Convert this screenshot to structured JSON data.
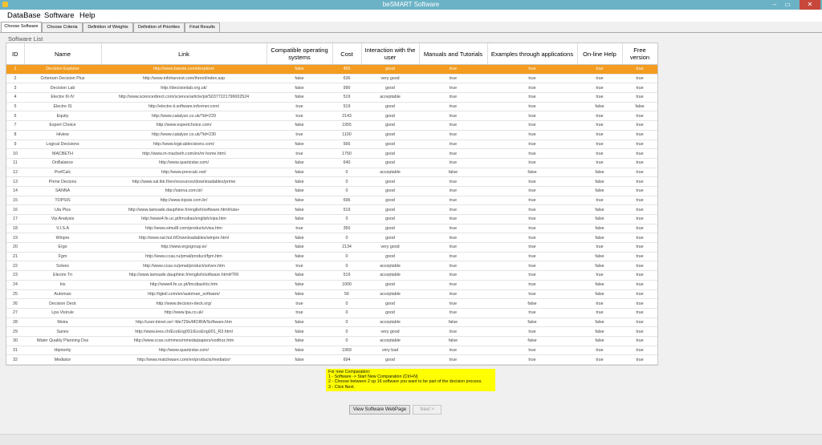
{
  "window": {
    "title": "beSMART Software",
    "minimize": "–",
    "maximize": "▭",
    "close": "✕"
  },
  "menu": [
    "DataBase",
    "Software",
    "Help"
  ],
  "tabs": [
    "Choose Software",
    "Choose Criteria",
    "Definition of Weights",
    "Definition of Priorities",
    "Final Results"
  ],
  "group_label": "Software List",
  "columns": [
    "ID",
    "Name",
    "Link",
    "Compatible operating systems",
    "Cost",
    "Interaction with the user",
    "Manuals and Tutorials",
    "Examples through applications",
    "On-line Help",
    "Free version"
  ],
  "selected_row_index": 0,
  "rows": [
    [
      "1",
      "Decision Explorer",
      "http://www.banxia.com/dexplore/",
      "false",
      "455",
      "good",
      "true",
      "true",
      "true",
      "true"
    ],
    [
      "2",
      "Criterium Decision Plus",
      "http://www.infoharvest.com/ihroot/index.asp",
      "false",
      "636",
      "very good",
      "true",
      "true",
      "true",
      "true"
    ],
    [
      "3",
      "Decision Lab",
      "http://decisionlab.org.uk/",
      "false",
      "990",
      "good",
      "true",
      "true",
      "true",
      "true"
    ],
    [
      "4",
      "Electre III-IV",
      "http://www.sciencedirect.com/science/article/pii/S0377221796002524",
      "false",
      "519",
      "acceptable",
      "true",
      "true",
      "true",
      "true"
    ],
    [
      "5",
      "Electre IS",
      "http://electre-ii.software.informer.com/",
      "true",
      "519",
      "good",
      "true",
      "true",
      "false",
      "false"
    ],
    [
      "6",
      "Equity",
      "http://www.catalyze.co.uk/?id=229",
      "true",
      "2143",
      "good",
      "true",
      "true",
      "true",
      "true"
    ],
    [
      "7",
      "Expert Choice",
      "http://www.expertchoice.com/",
      "false",
      "1955",
      "good",
      "true",
      "true",
      "true",
      "true"
    ],
    [
      "8",
      "Hiview",
      "http://www.catalyze.co.uk/?id=230",
      "true",
      "1100",
      "good",
      "true",
      "true",
      "true",
      "true"
    ],
    [
      "9",
      "Logical Decisions",
      "http://www.logicaldecisions.com/",
      "false",
      "566",
      "good",
      "true",
      "true",
      "true",
      "true"
    ],
    [
      "10",
      "MACBETH",
      "http://www.m-macbeth.com/en/m-home.html",
      "true",
      "1750",
      "good",
      "true",
      "true",
      "true",
      "true"
    ],
    [
      "11",
      "OnBalance",
      "http://www.quartzstar.com/",
      "false",
      "640",
      "good",
      "true",
      "true",
      "true",
      "true"
    ],
    [
      "12",
      "PrefCalc",
      "http://www.prevcalc.net/",
      "false",
      "0",
      "acceptable",
      "false",
      "false",
      "false",
      "true"
    ],
    [
      "13",
      "Prime Decions",
      "http://www.sal.tkk.fi/en/resources/downloadables/prime",
      "false",
      "0",
      "good",
      "true",
      "true",
      "false",
      "true"
    ],
    [
      "14",
      "SANNA",
      "http://sanna.com.br/",
      "false",
      "0",
      "good",
      "true",
      "true",
      "false",
      "true"
    ],
    [
      "15",
      "TOPSIS",
      "http://www.topsis.com.br/",
      "false",
      "696",
      "good",
      "true",
      "true",
      "true",
      "true"
    ],
    [
      "16",
      "Uta Plus",
      "http://www.lamsade.dauphine.fr/english/software.html#uta+",
      "false",
      "519",
      "good",
      "true",
      "true",
      "false",
      "true"
    ],
    [
      "17",
      "Vip Analysis",
      "http://www4.fe.uc.pt/lmcdias/english/vipa.htm",
      "false",
      "0",
      "good",
      "true",
      "true",
      "false",
      "true"
    ],
    [
      "18",
      "V.I.S.A",
      "http://www.simul8.com/products/visa.htm",
      "true",
      "350",
      "good",
      "true",
      "true",
      "false",
      "true"
    ],
    [
      "19",
      "Winpre",
      "http://www.sal.hut.fi/Downloadables/winpre.html",
      "false",
      "0",
      "good",
      "true",
      "true",
      "false",
      "true"
    ],
    [
      "20",
      "Ergo",
      "http://www.ergogroup.ie/",
      "false",
      "2134",
      "very good",
      "true",
      "true",
      "true",
      "true"
    ],
    [
      "21",
      "Fgm",
      "http://www.ccas.ru/pmal/product/fgm.htm",
      "false",
      "0",
      "good",
      "true",
      "true",
      "false",
      "true"
    ],
    [
      "22",
      "Solvex",
      "http://www.ccas.ru/pmal/product/solvex.htm",
      "true",
      "0",
      "acceptable",
      "true",
      "true",
      "false",
      "true"
    ],
    [
      "23",
      "Electre Tri",
      "http://www.lamsade.dauphine.fr/english/software.html#TRI",
      "false",
      "519",
      "acceptable",
      "true",
      "true",
      "true",
      "true"
    ],
    [
      "24",
      "Iris",
      "http://www4.fe.uc.pt/lmcdias/iris.htm",
      "false",
      "1000",
      "good",
      "true",
      "true",
      "false",
      "true"
    ],
    [
      "25",
      "Automan",
      "http://tgtoil.com/en/automan_software/",
      "false",
      "56",
      "acceptable",
      "true",
      "true",
      "false",
      "true"
    ],
    [
      "26",
      "Decision Deck",
      "http://www.decision-deck.org/",
      "true",
      "0",
      "good",
      "true",
      "false",
      "true",
      "true"
    ],
    [
      "27",
      "Lpa Visirule",
      "http://www.lpa.co.uk/",
      "true",
      "0",
      "good",
      "true",
      "true",
      "true",
      "true"
    ],
    [
      "28",
      "Moira",
      "http://user.tninet.se/~fde729o/MOIRA/Software.htm",
      "false",
      "0",
      "acceptable",
      "false",
      "false",
      "false",
      "true"
    ],
    [
      "29",
      "Sanex",
      "http://www.iees.ch/EcoEng001/EcoEng001_R3.html",
      "false",
      "0",
      "very good",
      "true",
      "true",
      "false",
      "true"
    ],
    [
      "30",
      "Water Quality Planning Dss",
      "http://www.ccas.ru/mmes/mmeda/papers/vodhoz.htm",
      "false",
      "0",
      "acceptable",
      "false",
      "false",
      "false",
      "true"
    ],
    [
      "31",
      "Hipriority",
      "http://www.quartzstar.com/",
      "false",
      "1969",
      "very bad",
      "true",
      "true",
      "true",
      "true"
    ],
    [
      "32",
      "Mediator",
      "http://www.matchware.com/en/products/mediator/",
      "false",
      "694",
      "good",
      "true",
      "true",
      "true",
      "true"
    ]
  ],
  "note": [
    "For new Comparation:",
    "1 - Software -> Start New Comparation (Ctrl+N)",
    "2 - Choose between 2 up 16 software you want to be part of the decision process.",
    "3 - Click Next."
  ],
  "buttons": {
    "view": "View Software WebPage",
    "next": "Next >"
  },
  "colors": {
    "titlebar": "#6bb2c6",
    "selection": "#f39c1f",
    "note_bg": "#ffff00"
  }
}
